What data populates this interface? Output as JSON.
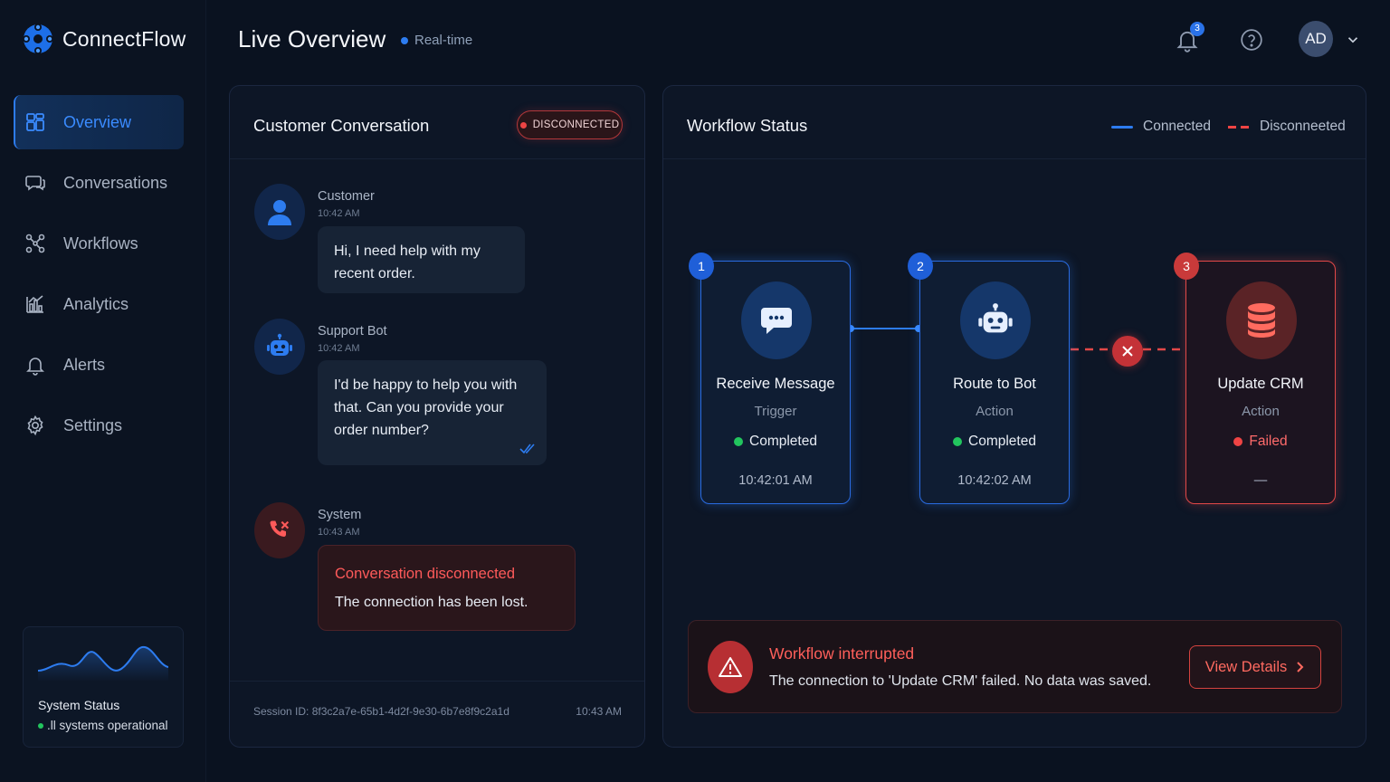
{
  "app": {
    "name": "ConnectFlow"
  },
  "header": {
    "title": "Live Overview",
    "live_label": "Real-time",
    "notifications_count": "3",
    "user_initials": "AD"
  },
  "sidebar": {
    "items": [
      {
        "label": "Overview",
        "icon": "dashboard-icon",
        "active": true
      },
      {
        "label": "Conversations",
        "icon": "chat-icon"
      },
      {
        "label": "Workflows",
        "icon": "workflow-icon"
      },
      {
        "label": "Analytics",
        "icon": "analytics-icon"
      },
      {
        "label": "Alerts",
        "icon": "bell-icon"
      },
      {
        "label": "Settings",
        "icon": "gear-icon"
      }
    ],
    "system_status": {
      "title": "System Status",
      "subtitle": ".ll systems operational"
    }
  },
  "conversation": {
    "title": "Customer Conversation",
    "status_badge": "DISCONNECTED",
    "messages": [
      {
        "sender": "Customer",
        "time": "10:42 AM",
        "text": "Hi, I need help with my recent order."
      },
      {
        "sender": "Support Bot",
        "time": "10:42 AM",
        "text": "I'd be happy to help you with that. Can you provide your order number?"
      },
      {
        "sender": "System",
        "time": "10:43 AM",
        "title": "Conversation disconnected",
        "text": "The connection has been lost."
      }
    ],
    "session_id": "Session ID: 8f3c2a7e-65b1-4d2f-9e30-6b7e8f9c2a1d",
    "session_time": "10:43 AM"
  },
  "workflow": {
    "title": "Workflow Status",
    "legend": {
      "connected": "Connected",
      "disconnected": "Disconneeted"
    },
    "nodes": [
      {
        "num": "1",
        "title": "Receive Message",
        "type": "Trigger",
        "status": "Completed",
        "time": "10:42:01 AM"
      },
      {
        "num": "2",
        "title": "Route to Bot",
        "type": "Action",
        "status": "Completed",
        "time": "10:42:02 AM"
      },
      {
        "num": "3",
        "title": "Update CRM",
        "type": "Action",
        "status": "Failed",
        "time": "—"
      }
    ],
    "alert": {
      "title": "Workflow interrupted",
      "text": "The connection to 'Update CRM' failed. No data was saved.",
      "button": "View Details"
    }
  },
  "colors": {
    "accent": "#2d7cf0",
    "error": "#ef4444",
    "success": "#22c55e",
    "background": "#0a1220"
  }
}
